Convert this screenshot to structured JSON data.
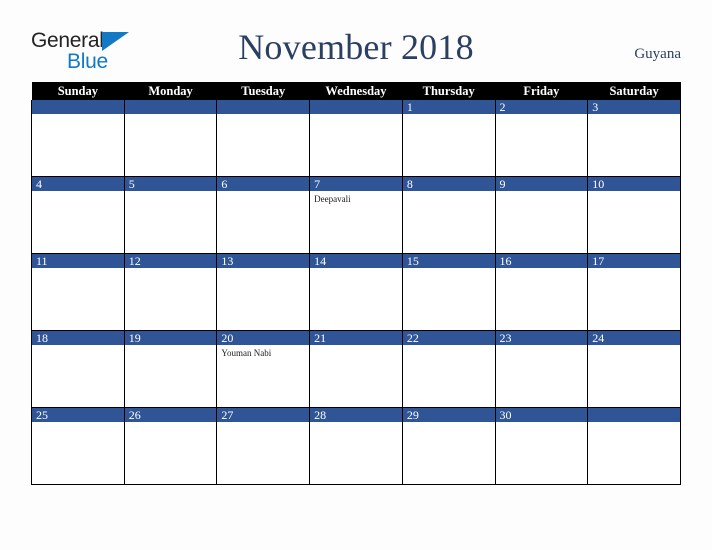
{
  "brand": {
    "name_part1": "General",
    "name_part2": "Blue",
    "triangle_color": "#1279c4"
  },
  "header": {
    "title": "November 2018",
    "region": "Guyana"
  },
  "colors": {
    "accent_blue": "#2f5597",
    "header_bar": "#000000",
    "title_text": "#2b3f63",
    "logo_blue": "#1279c4",
    "page_background": "#fdfdfe"
  },
  "calendar": {
    "month": "November",
    "year": "2018",
    "weekday_headers": [
      "Sunday",
      "Monday",
      "Tuesday",
      "Wednesday",
      "Thursday",
      "Friday",
      "Saturday"
    ],
    "weeks": [
      [
        {
          "day": "",
          "event": ""
        },
        {
          "day": "",
          "event": ""
        },
        {
          "day": "",
          "event": ""
        },
        {
          "day": "",
          "event": ""
        },
        {
          "day": "1",
          "event": ""
        },
        {
          "day": "2",
          "event": ""
        },
        {
          "day": "3",
          "event": ""
        }
      ],
      [
        {
          "day": "4",
          "event": ""
        },
        {
          "day": "5",
          "event": ""
        },
        {
          "day": "6",
          "event": ""
        },
        {
          "day": "7",
          "event": "Deepavali"
        },
        {
          "day": "8",
          "event": ""
        },
        {
          "day": "9",
          "event": ""
        },
        {
          "day": "10",
          "event": ""
        }
      ],
      [
        {
          "day": "11",
          "event": ""
        },
        {
          "day": "12",
          "event": ""
        },
        {
          "day": "13",
          "event": ""
        },
        {
          "day": "14",
          "event": ""
        },
        {
          "day": "15",
          "event": ""
        },
        {
          "day": "16",
          "event": ""
        },
        {
          "day": "17",
          "event": ""
        }
      ],
      [
        {
          "day": "18",
          "event": ""
        },
        {
          "day": "19",
          "event": ""
        },
        {
          "day": "20",
          "event": "Youman Nabi"
        },
        {
          "day": "21",
          "event": ""
        },
        {
          "day": "22",
          "event": ""
        },
        {
          "day": "23",
          "event": ""
        },
        {
          "day": "24",
          "event": ""
        }
      ],
      [
        {
          "day": "25",
          "event": ""
        },
        {
          "day": "26",
          "event": ""
        },
        {
          "day": "27",
          "event": ""
        },
        {
          "day": "28",
          "event": ""
        },
        {
          "day": "29",
          "event": ""
        },
        {
          "day": "30",
          "event": ""
        },
        {
          "day": "",
          "event": ""
        }
      ]
    ]
  }
}
